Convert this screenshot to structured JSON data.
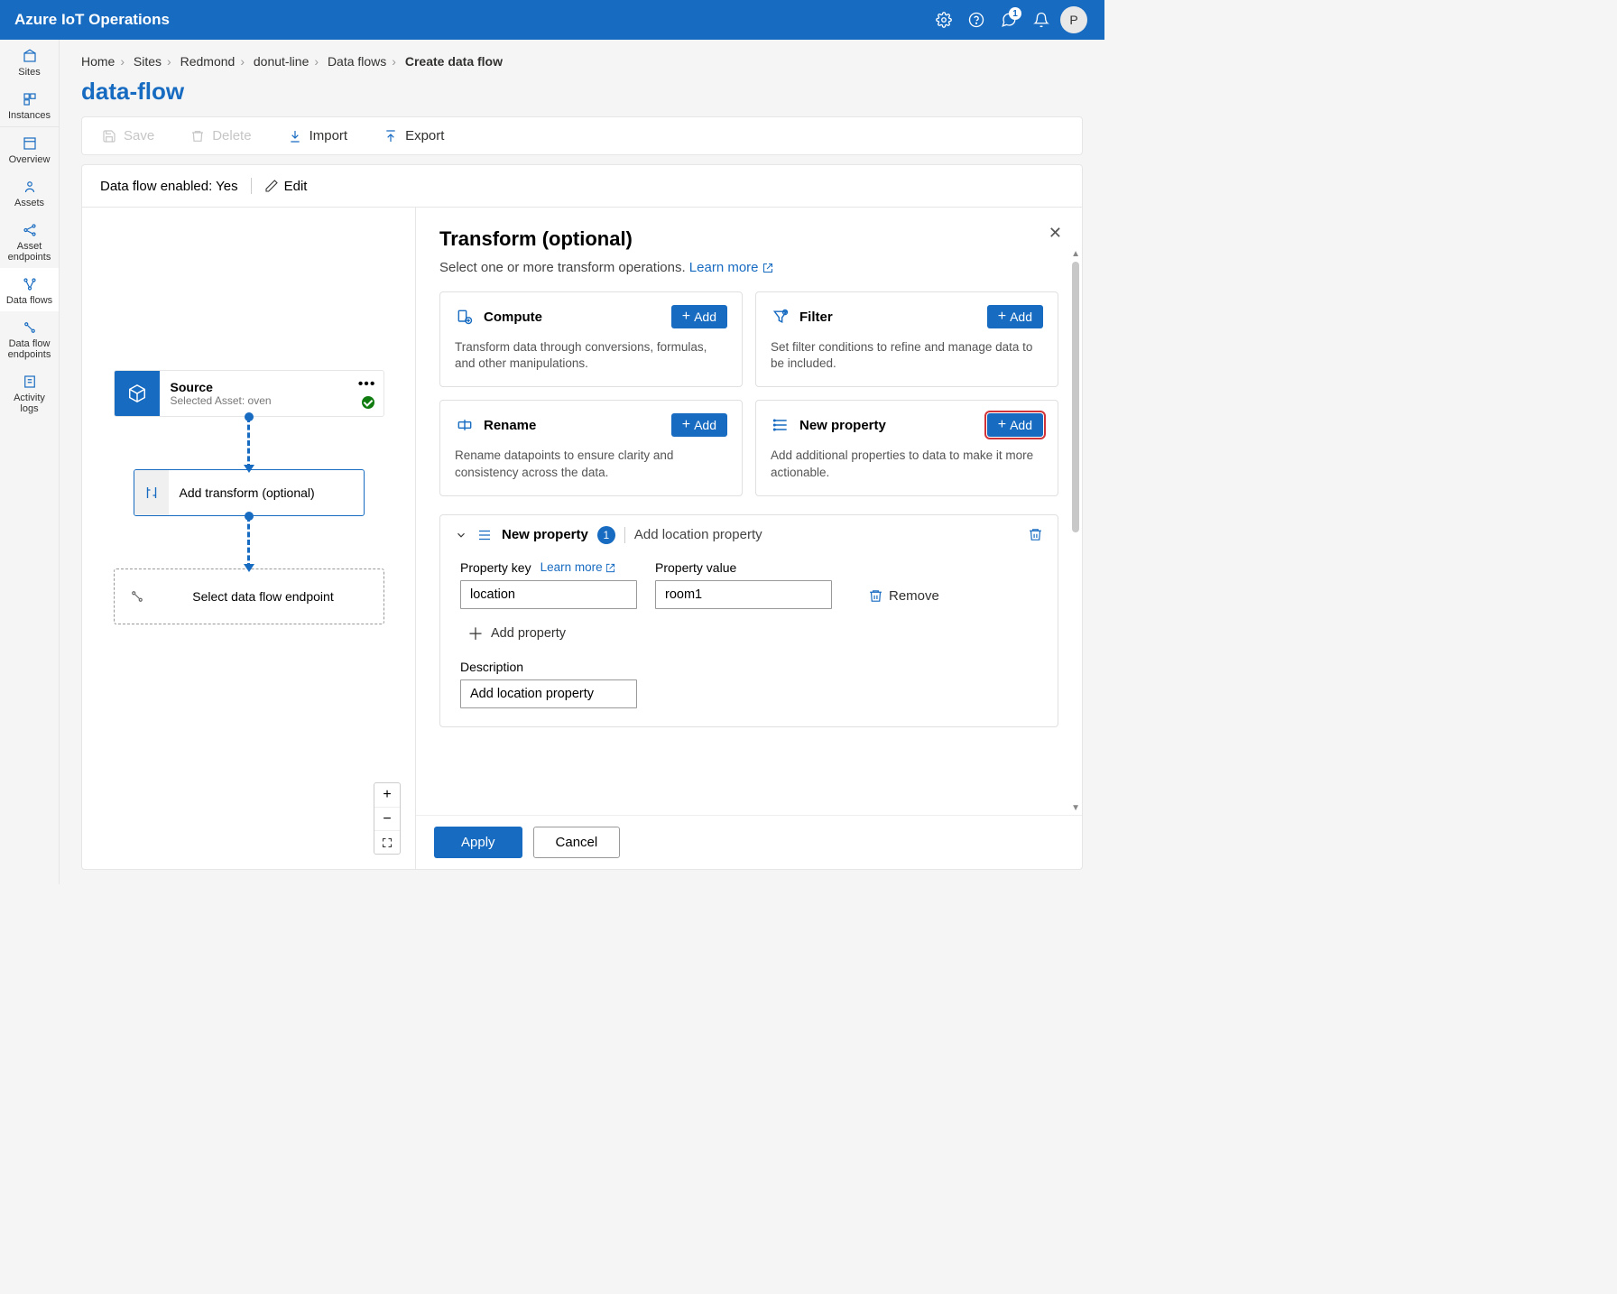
{
  "header": {
    "brand": "Azure IoT Operations",
    "avatar": "P",
    "feedback_badge": "1"
  },
  "sidebar": {
    "items": [
      {
        "label": "Sites"
      },
      {
        "label": "Instances"
      },
      {
        "label": "Overview"
      },
      {
        "label": "Assets"
      },
      {
        "label": "Asset endpoints"
      },
      {
        "label": "Data flows"
      },
      {
        "label": "Data flow endpoints"
      },
      {
        "label": "Activity logs"
      }
    ]
  },
  "breadcrumb": {
    "home": "Home",
    "sites": "Sites",
    "region": "Redmond",
    "line": "donut-line",
    "flows": "Data flows",
    "current": "Create data flow"
  },
  "page_title": "data-flow",
  "toolbar": {
    "save": "Save",
    "delete": "Delete",
    "import": "Import",
    "export": "Export"
  },
  "status": {
    "label": "Data flow enabled: Yes",
    "edit": "Edit"
  },
  "canvas": {
    "source": {
      "title": "Source",
      "subtitle": "Selected Asset: oven"
    },
    "transform": "Add transform (optional)",
    "endpoint": "Select data flow endpoint"
  },
  "panel": {
    "title": "Transform (optional)",
    "desc": "Select one or more transform operations. ",
    "learn_more": "Learn more",
    "cards": {
      "compute": {
        "title": "Compute",
        "desc": "Transform data through conversions, formulas, and other manipulations.",
        "add": "Add"
      },
      "filter": {
        "title": "Filter",
        "desc": "Set filter conditions to refine and manage data to be included.",
        "add": "Add"
      },
      "rename": {
        "title": "Rename",
        "desc": "Rename datapoints to ensure clarity and consistency across the data.",
        "add": "Add"
      },
      "newprop": {
        "title": "New property",
        "desc": "Add additional properties to data to make it more actionable.",
        "add": "Add"
      }
    },
    "accordion": {
      "title": "New property",
      "count": "1",
      "subtitle": "Add location property",
      "fields": {
        "key_label": "Property key",
        "learn_more": "Learn more",
        "key_value": "location",
        "value_label": "Property value",
        "value_value": "room1",
        "remove": "Remove",
        "add_property": "Add property",
        "desc_label": "Description",
        "desc_value": "Add location property"
      }
    },
    "footer": {
      "apply": "Apply",
      "cancel": "Cancel"
    }
  }
}
